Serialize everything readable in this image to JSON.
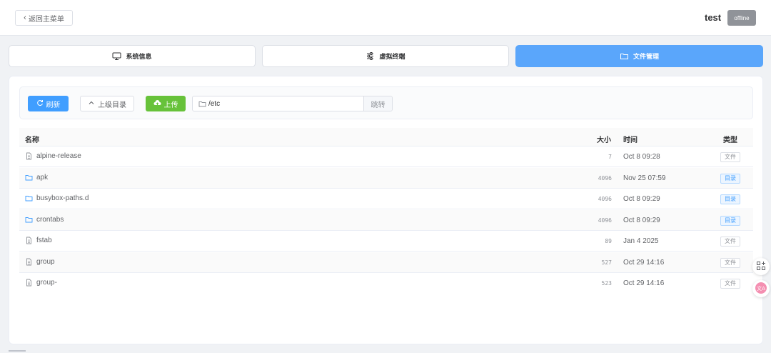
{
  "header": {
    "back_label": "返回主菜单",
    "host_name": "test",
    "status": "offline"
  },
  "tabs": [
    {
      "label": "系统信息",
      "icon": "monitor-icon",
      "active": false
    },
    {
      "label": "虚拟终端",
      "icon": "sliders-icon",
      "active": false
    },
    {
      "label": "文件管理",
      "icon": "folder-icon",
      "active": true
    }
  ],
  "toolbar": {
    "refresh_label": "刷新",
    "up_label": "上级目录",
    "upload_label": "上传",
    "path_value": "/etc",
    "jump_label": "跳转"
  },
  "table": {
    "headers": {
      "name": "名称",
      "size": "大小",
      "time": "时间",
      "type": "类型"
    },
    "rows": [
      {
        "name": "alpine-release",
        "size": "7",
        "time": "Oct 8 09:28",
        "type": "文件",
        "is_dir": false
      },
      {
        "name": "apk",
        "size": "4096",
        "time": "Nov 25 07:59",
        "type": "目录",
        "is_dir": true
      },
      {
        "name": "busybox-paths.d",
        "size": "4096",
        "time": "Oct 8 09:29",
        "type": "目录",
        "is_dir": true
      },
      {
        "name": "crontabs",
        "size": "4096",
        "time": "Oct 8 09:29",
        "type": "目录",
        "is_dir": true
      },
      {
        "name": "fstab",
        "size": "89",
        "time": "Jan 4 2025",
        "type": "文件",
        "is_dir": false
      },
      {
        "name": "group",
        "size": "527",
        "time": "Oct 29 14:16",
        "type": "文件",
        "is_dir": false
      },
      {
        "name": "group-",
        "size": "523",
        "time": "Oct 29 14:16",
        "type": "文件",
        "is_dir": false
      }
    ]
  },
  "colors": {
    "primary": "#409eff",
    "active_tab": "#5aa6fb",
    "upload": "#67c23a",
    "offline": "#909399"
  }
}
